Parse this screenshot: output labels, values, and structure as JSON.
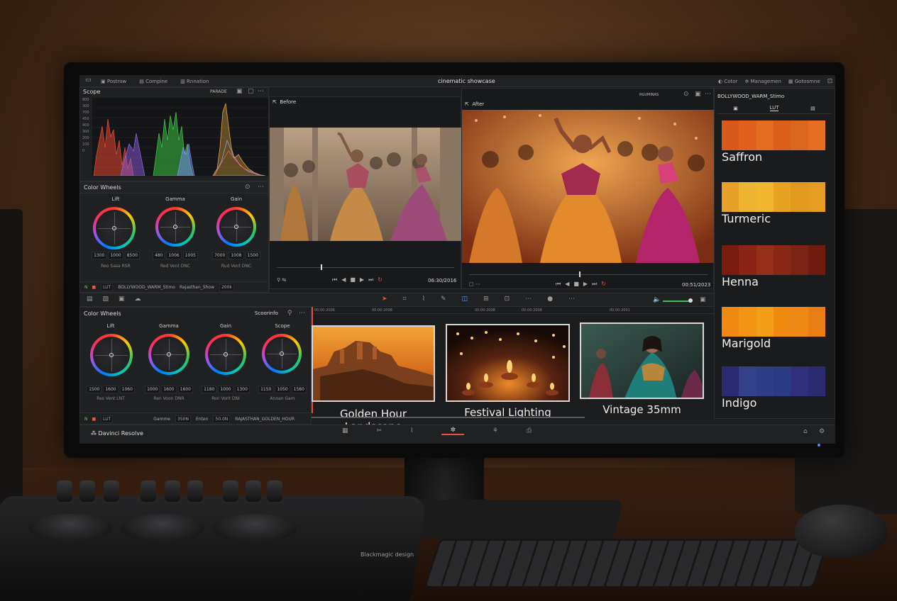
{
  "window": {
    "title": "cinematic showcase",
    "app_name": "Davinci Resolve"
  },
  "topbar": {
    "left_tabs": [
      {
        "label": "Postrow"
      },
      {
        "label": "Compine"
      },
      {
        "label": "Rnnation"
      }
    ],
    "right_tabs": [
      {
        "label": "Cotor"
      },
      {
        "label": "Managemen"
      },
      {
        "label": "Gotosmne"
      }
    ],
    "right_title": "BOLLYWOOD_WARM_Stimo",
    "right_tabs_sub": "LUT"
  },
  "scope": {
    "title": "Scope",
    "mode": "PARADE",
    "axis": [
      "800",
      "300",
      "700",
      "450",
      "400",
      "300",
      "200",
      "100",
      "0"
    ]
  },
  "color_wheels_top": {
    "title": "Color Wheels",
    "wheels": [
      {
        "name": "Lift",
        "values": [
          "1300",
          "1000",
          "8500"
        ],
        "labels": [
          "Reo",
          "Sasa",
          "RSR"
        ]
      },
      {
        "name": "Gamma",
        "values": [
          "480",
          "1006",
          "1005"
        ],
        "labels": [
          "Red",
          "Vent",
          "DNC"
        ]
      },
      {
        "name": "Gain",
        "values": [
          "7000",
          "1008",
          "1500"
        ],
        "labels": [
          "Rud",
          "Vent",
          "DNC"
        ]
      }
    ],
    "footer": {
      "lut": "LUT",
      "lut_name": "BOLLYWOOD_WARM_Stimo",
      "field_label": "Rajasthan_Show",
      "field_value": "200k"
    }
  },
  "viewer_before": {
    "label": "Before",
    "timecode": "06:30/2016"
  },
  "viewer_after": {
    "label": "After",
    "timecode": "00:51/2023",
    "top_control": "RGUMINAS"
  },
  "toolbar_mid": {
    "label": "Scoorinfo"
  },
  "color_wheels_bottom": {
    "title": "Color Wheels",
    "wheels": [
      {
        "name": "Lift",
        "values": [
          "1500",
          "1600",
          "1060"
        ],
        "labels": [
          "Res",
          "Vent",
          "LNT"
        ]
      },
      {
        "name": "Gamma",
        "values": [
          "1000",
          "1600",
          "1600"
        ],
        "labels": [
          "Ren",
          "Voon",
          "DNR"
        ]
      },
      {
        "name": "Gain",
        "values": [
          "1180",
          "1000",
          "1300"
        ],
        "labels": [
          "Ron",
          "Vont",
          "DNI"
        ]
      },
      {
        "name": "Scope",
        "values": [
          "1150",
          "1050",
          "1580"
        ],
        "labels": [
          "Anoan",
          "Gam",
          ""
        ]
      }
    ],
    "footer": {
      "lut": "LUT",
      "gamma_label": "Gamme",
      "gamma_value": "350N",
      "ent_label": "Enten",
      "ent_value": "50.0N",
      "lut_name": "RAJASTHAN_GOLDEN_HOUR"
    }
  },
  "timeline": {
    "timecodes": [
      "00:00:2006",
      "00:00:2008",
      "00:00:2008",
      "00:00:2008",
      "00:00:2001"
    ],
    "clips": [
      {
        "name": "Golden Hour Landscape"
      },
      {
        "name": "Festival Lighting"
      },
      {
        "name": "Vintage 35mm"
      }
    ]
  },
  "palettes": [
    {
      "name": "Saffron",
      "colors": [
        "#d9591a",
        "#e0611c",
        "#e36d1f",
        "#dc5f19",
        "#d9681d",
        "#e56e22"
      ]
    },
    {
      "name": "Turmeric",
      "colors": [
        "#e8a22a",
        "#edb431",
        "#f0b72e",
        "#e9a323",
        "#e19a1e",
        "#e49c22"
      ]
    },
    {
      "name": "Henna",
      "colors": [
        "#7a1a10",
        "#8a2416",
        "#94301a",
        "#8a2716",
        "#7c2414",
        "#6e1c10"
      ]
    },
    {
      "name": "Marigold",
      "colors": [
        "#f08a12",
        "#f39414",
        "#f59f18",
        "#f08b12",
        "#ee8a15",
        "#e97c12"
      ]
    },
    {
      "name": "Indigo",
      "colors": [
        "#2c2a73",
        "#34428e",
        "#2d3e86",
        "#2a3a83",
        "#312e7c",
        "#2c2b70"
      ]
    }
  ],
  "hardware": {
    "console_brand": "Blackmagic design"
  }
}
